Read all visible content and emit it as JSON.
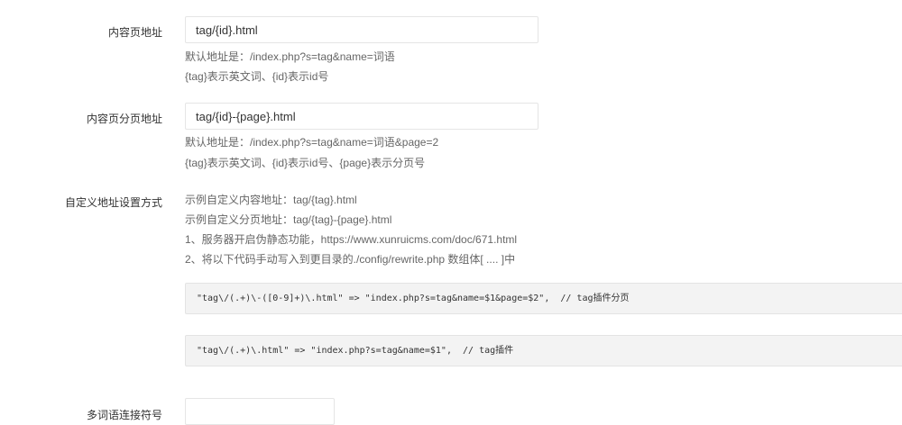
{
  "fields": {
    "content_url": {
      "label": "内容页地址",
      "value": "tag/{id}.html",
      "help": [
        "默认地址是：/index.php?s=tag&name=词语",
        "{tag}表示英文词、{id}表示id号"
      ]
    },
    "content_page_url": {
      "label": "内容页分页地址",
      "value": "tag/{id}-{page}.html",
      "help": [
        "默认地址是：/index.php?s=tag&name=词语&page=2",
        "{tag}表示英文词、{id}表示id号、{page}表示分页号"
      ]
    },
    "custom_url": {
      "label": "自定义地址设置方式",
      "help": [
        "示例自定义内容地址：tag/{tag}.html",
        "示例自定义分页地址：tag/{tag}-{page}.html",
        "1、服务器开启伪静态功能，https://www.xunruicms.com/doc/671.html",
        "2、将以下代码手动写入到更目录的./config/rewrite.php 数组体[ .... ]中"
      ],
      "code": [
        "\"tag\\/(.+)\\-([0-9]+)\\.html\" => \"index.php?s=tag&name=$1&page=$2\",  // tag插件分页",
        "\"tag\\/(.+)\\.html\" => \"index.php?s=tag&name=$1\",  // tag插件"
      ]
    },
    "connector": {
      "label": "多词语连接符号",
      "value": ""
    }
  }
}
